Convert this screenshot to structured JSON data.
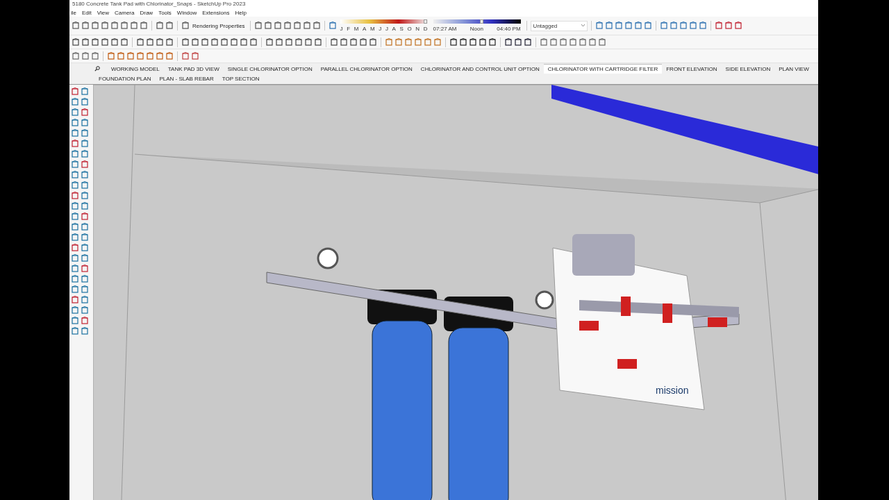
{
  "window": {
    "title": "5180 Concrete Tank Pad with Chlorinator_Snaps - SketchUp Pro 2023"
  },
  "menu": [
    "ile",
    "Edit",
    "View",
    "Camera",
    "Draw",
    "Tools",
    "Window",
    "Extensions",
    "Help"
  ],
  "toolbar": {
    "rendering_button": "Rendering Properties",
    "shadow_months": [
      "J",
      "F",
      "M",
      "A",
      "M",
      "J",
      "J",
      "A",
      "S",
      "O",
      "N",
      "D"
    ],
    "date_slider": {
      "level": 0.97
    },
    "time_slider": {
      "level": 0.55
    },
    "time_labels": [
      "07:27 AM",
      "Noon",
      "04:40 PM"
    ],
    "tag_dropdown": "Untagged"
  },
  "scene_tabs": [
    {
      "label": "WORKING MODEL",
      "selected": false
    },
    {
      "label": "TANK PAD 3D VIEW",
      "selected": false
    },
    {
      "label": "SINGLE CHLORINATOR OPTION",
      "selected": false
    },
    {
      "label": "PARALLEL CHLORINATOR OPTION",
      "selected": false
    },
    {
      "label": "CHLORINATOR AND CONTROL UNIT OPTION",
      "selected": false
    },
    {
      "label": "CHLORINATOR WITH CARTRIDGE FILTER",
      "selected": true
    },
    {
      "label": "FRONT ELEVATION",
      "selected": false
    },
    {
      "label": "SIDE ELEVATION",
      "selected": false
    },
    {
      "label": "PLAN VIEW",
      "selected": false
    },
    {
      "label": "FOUNDATION PLAN",
      "selected": false
    },
    {
      "label": "PLAN - SLAB REBAR",
      "selected": false
    },
    {
      "label": "TOP SECTION",
      "selected": false
    }
  ],
  "viewport": {
    "sign_text": "mission"
  }
}
